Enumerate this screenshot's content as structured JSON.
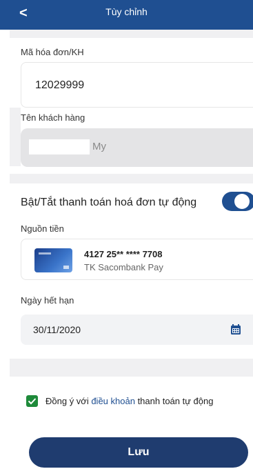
{
  "header": {
    "back_icon": "<",
    "title": "Tùy chỉnh"
  },
  "invoice": {
    "label": "Mã hóa đơn/KH",
    "value": "12029999"
  },
  "customer": {
    "label": "Tên khách hàng",
    "value": "My"
  },
  "autopay": {
    "label": "Bật/Tắt thanh toán hoá đơn tự động",
    "enabled": true
  },
  "source": {
    "label": "Nguồn tiền",
    "card_number": "4127 25** **** 7708",
    "card_name": "TK Sacombank Pay"
  },
  "expiry": {
    "label": "Ngày hết hạn",
    "value": "30/11/2020",
    "icon": "calendar-icon"
  },
  "consent": {
    "checked": true,
    "prefix": "Đồng ý với ",
    "link": "điều khoản",
    "suffix": " thanh toán tự động"
  },
  "save_button": {
    "label": "Lưu"
  },
  "colors": {
    "primary": "#1f4f91",
    "button": "#1f3c6f",
    "check": "#1e8a3a"
  }
}
